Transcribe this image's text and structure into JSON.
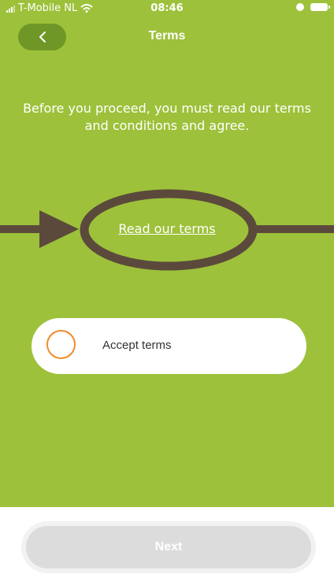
{
  "status_bar": {
    "carrier": "T-Mobile NL",
    "time": "08:46"
  },
  "nav": {
    "title": "Terms",
    "back_icon": "chevron-left-icon"
  },
  "intro_text": "Before you proceed, you must read our terms and conditions and agree.",
  "read_terms_link": "Read our terms",
  "accept": {
    "label": "Accept terms",
    "checked": false
  },
  "next_button": {
    "label": "Next",
    "enabled": false
  },
  "colors": {
    "background": "#9dc13a",
    "back_button": "#6f9728",
    "radio_border": "#f08a2a",
    "annotation": "#5b4a3c"
  }
}
